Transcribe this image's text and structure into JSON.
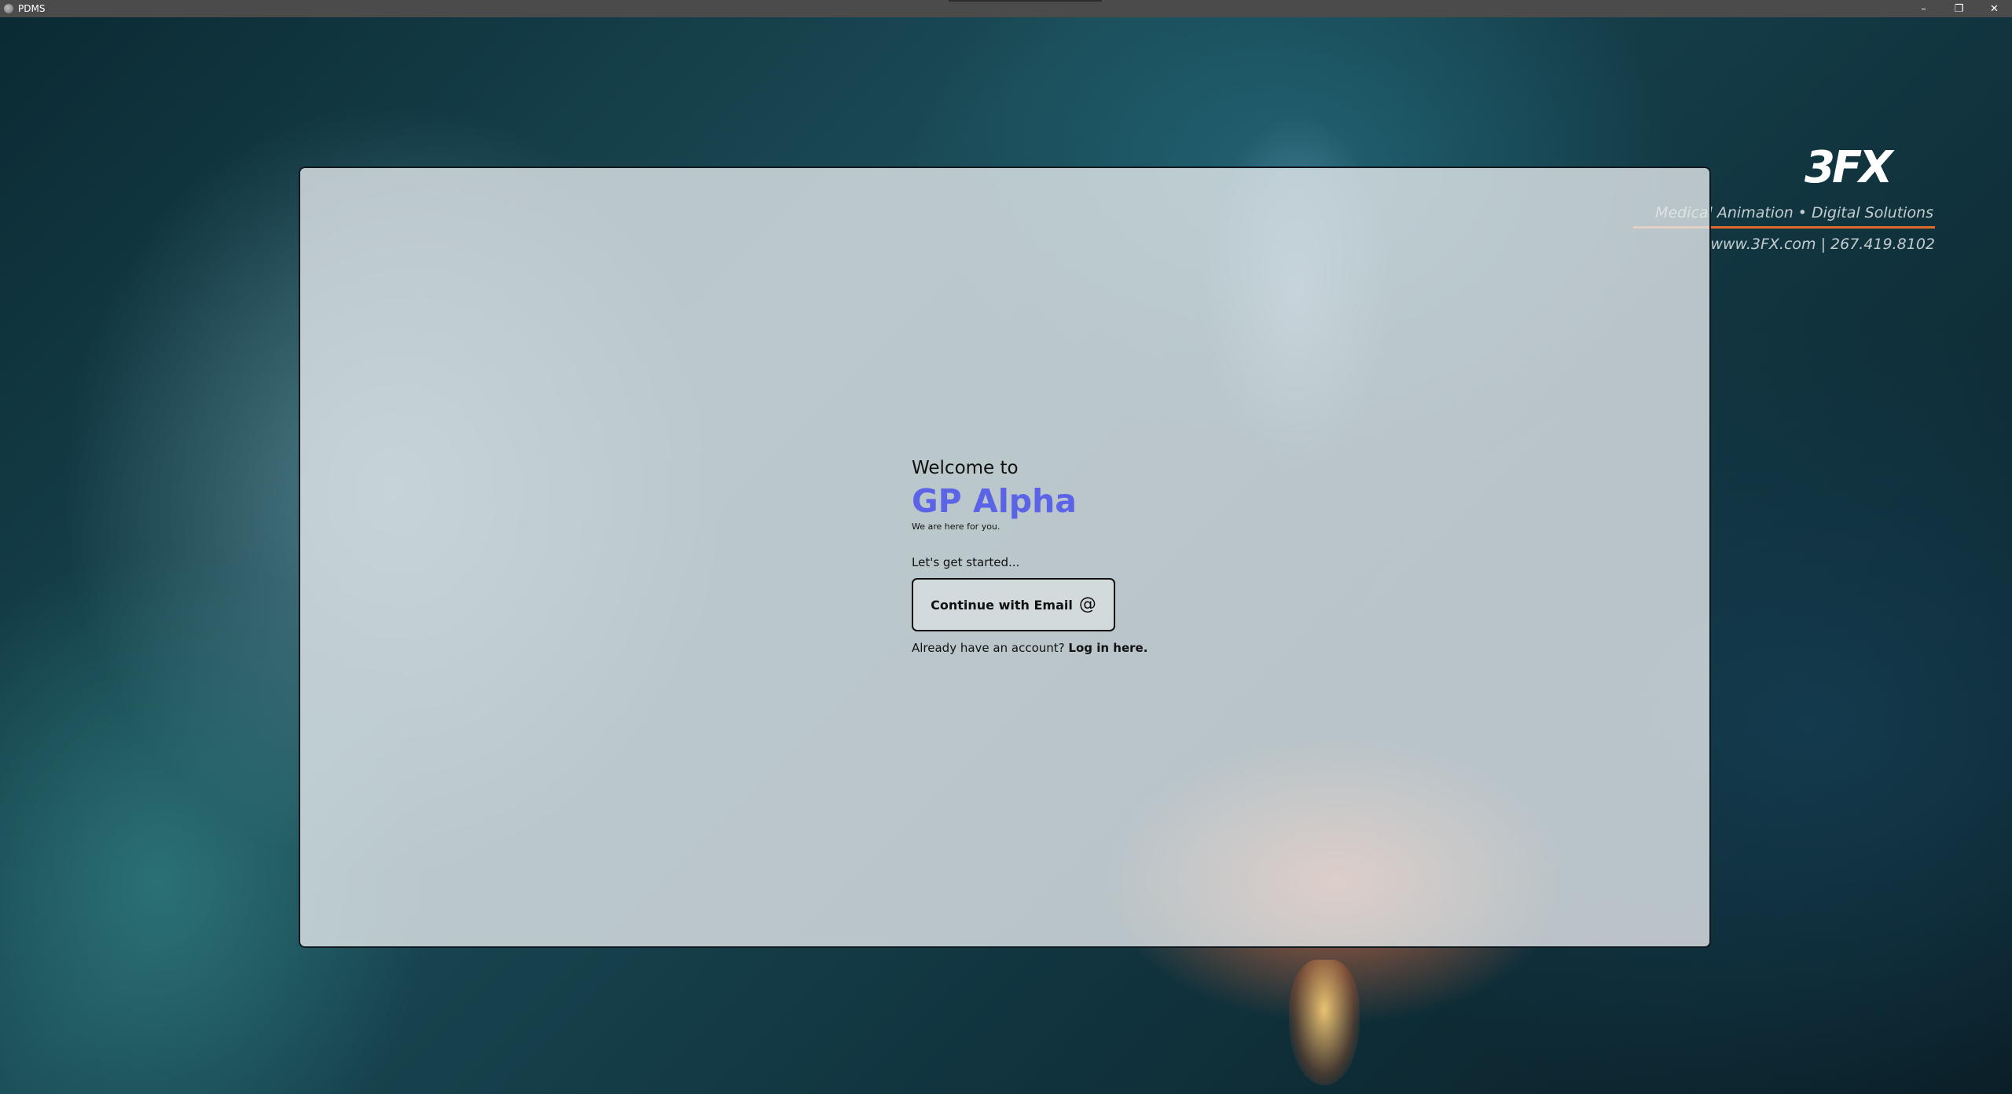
{
  "window": {
    "title": "PDMS",
    "controls": {
      "minimize_glyph": "–",
      "restore_glyph": "❐",
      "close_glyph": "✕"
    }
  },
  "background_logo": {
    "brand": "3FX",
    "tagline": "Medical Animation • Digital Solutions",
    "contact": "www.3FX.com | 267.419.8102",
    "rule_color": "#e06a2a"
  },
  "welcome": {
    "intro": "Welcome to",
    "brand_name": "GP Alpha",
    "brand_color": "#5b63e6",
    "tagline": "We are here for you.",
    "get_started": "Let's get started...",
    "continue_email_label": "Continue with Email",
    "continue_email_icon": "at-icon",
    "at_glyph": "@",
    "login_prompt": "Already have an account?",
    "login_link": "Log in here."
  }
}
